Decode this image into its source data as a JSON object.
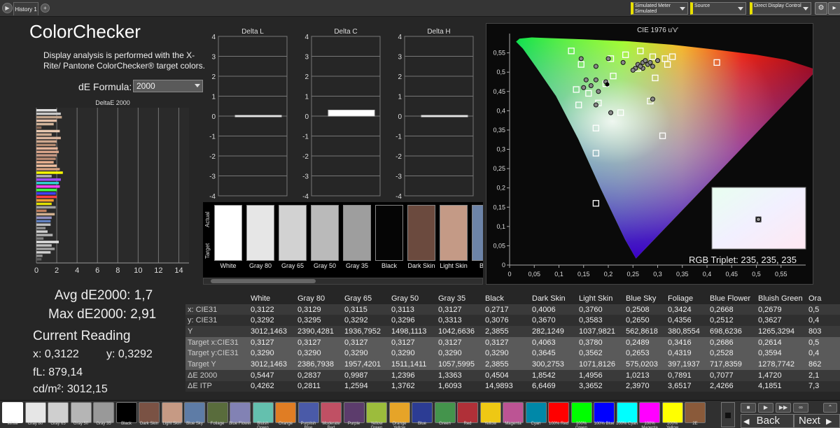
{
  "tabs": {
    "history": "History 1",
    "add": "+"
  },
  "toolbar": {
    "meter_line1": "Simulated Meter",
    "meter_line2": "Simulated",
    "source": "Source",
    "display_control": "Direct Display Control"
  },
  "title": "ColorChecker",
  "description": "Display analysis is performed with the X-Rite/ Pantone ColorChecker® target colors.",
  "de_formula": {
    "label": "dE Formula:",
    "value": "2000"
  },
  "stats": {
    "avg": "Avg dE2000: 1,7",
    "max": "Max dE2000: 2,91",
    "current_label": "Current Reading",
    "x": "x: 0,3122",
    "y": "y: 0,3292",
    "fl": "fL: 879,14",
    "cdm": "cd/m²: 3012,15"
  },
  "rgb_triplet": "RGB Triplet: 235, 235, 235",
  "chart_data": [
    {
      "type": "bar",
      "title": "DeltaE 2000",
      "orientation": "horizontal",
      "xlim": [
        0,
        15
      ],
      "xticks": [
        "0",
        "2",
        "4",
        "6",
        "8",
        "10",
        "12",
        "14"
      ],
      "values": [
        2.0,
        2.4,
        2.5,
        2.0,
        1.7,
        0.5,
        2.3,
        1.5,
        2.4,
        2.0,
        1.9,
        2.1,
        2.2,
        2.0,
        1.9,
        1.7,
        2.0,
        2.3,
        2.6,
        1.5,
        2.4,
        2.2,
        2.3,
        2.0,
        1.9,
        2.0,
        1.7,
        1.5,
        1.9,
        1.0,
        1.8,
        1.5,
        1.4,
        1.4,
        0.9,
        1.1,
        1.6,
        0.7,
        2.2,
        1.5,
        1.8,
        1.4,
        0.6,
        0.5
      ],
      "colors": [
        "#e0e0e0",
        "#c8c8c8",
        "#c2a48c",
        "#e4c0a8",
        "#d2b49a",
        "#8c6c5a",
        "#e8c8b0",
        "#ccaa90",
        "#d9b39c",
        "#cfa88e",
        "#b38a70",
        "#e5b59a",
        "#d9a58a",
        "#c89a84",
        "#b88a72",
        "#e8b090",
        "#f0c0a0",
        "#d4a080",
        "#ffff00",
        "#b0b0b0",
        "#a050ff",
        "#30d0d0",
        "#ff40ff",
        "#40ff40",
        "#4040ff",
        "#ff4040",
        "#ffa030",
        "#e0e000",
        "#a0a0a0",
        "#c08060",
        "#d0b090",
        "#9090c0",
        "#6080c0",
        "#c0c0c0",
        "#909090",
        "#d0d0d0",
        "#b0b0b0",
        "#808080",
        "#e0e0e0",
        "#c0c0c0",
        "#a0a0a0",
        "#d0d0d0",
        "#909090",
        "#606060"
      ]
    },
    {
      "type": "bar",
      "title": "Delta L",
      "ylim": [
        -4,
        4
      ],
      "yticks": [
        "4",
        "3",
        "2",
        "1",
        "0",
        "-1",
        "-2",
        "-3",
        "-4"
      ],
      "values": [
        0.0
      ]
    },
    {
      "type": "bar",
      "title": "Delta C",
      "ylim": [
        -4,
        4
      ],
      "yticks": [
        "4",
        "3",
        "2",
        "1",
        "0",
        "-1",
        "-2",
        "-3",
        "-4"
      ],
      "values": [
        0.3
      ]
    },
    {
      "type": "bar",
      "title": "Delta H",
      "ylim": [
        -4,
        4
      ],
      "yticks": [
        "4",
        "3",
        "2",
        "1",
        "0",
        "-1",
        "-2",
        "-3",
        "-4"
      ],
      "values": [
        0.0
      ]
    },
    {
      "type": "scatter",
      "title": "CIE 1976 u'v'",
      "xlim": [
        0,
        0.6
      ],
      "ylim": [
        0,
        0.6
      ],
      "xticks": [
        "0",
        "0,05",
        "0,1",
        "0,15",
        "0,2",
        "0,25",
        "0,3",
        "0,35",
        "0,4",
        "0,45",
        "0,5",
        "0,55"
      ],
      "yticks": [
        "0,55",
        "0,5",
        "0,45",
        "0,4",
        "0,35",
        "0,3",
        "0,25",
        "0,2",
        "0,15",
        "0,1",
        "0,05",
        "0"
      ],
      "targets": [
        [
          0.125,
          0.555
        ],
        [
          0.145,
          0.52
        ],
        [
          0.265,
          0.555
        ],
        [
          0.29,
          0.54
        ],
        [
          0.315,
          0.535
        ],
        [
          0.33,
          0.54
        ],
        [
          0.42,
          0.525
        ],
        [
          0.32,
          0.52
        ],
        [
          0.26,
          0.51
        ],
        [
          0.21,
          0.49
        ],
        [
          0.295,
          0.485
        ],
        [
          0.195,
          0.47
        ],
        [
          0.135,
          0.455
        ],
        [
          0.16,
          0.445
        ],
        [
          0.285,
          0.425
        ],
        [
          0.14,
          0.415
        ],
        [
          0.18,
          0.42
        ],
        [
          0.225,
          0.395
        ],
        [
          0.31,
          0.335
        ],
        [
          0.175,
          0.355
        ],
        [
          0.175,
          0.29
        ],
        [
          0.175,
          0.16
        ],
        [
          0.205,
          0.535
        ],
        [
          0.235,
          0.545
        ]
      ],
      "measured": [
        [
          0.145,
          0.535
        ],
        [
          0.175,
          0.515
        ],
        [
          0.2,
          0.535
        ],
        [
          0.23,
          0.525
        ],
        [
          0.26,
          0.52
        ],
        [
          0.27,
          0.525
        ],
        [
          0.275,
          0.53
        ],
        [
          0.28,
          0.52
        ],
        [
          0.29,
          0.515
        ],
        [
          0.3,
          0.53
        ],
        [
          0.285,
          0.525
        ],
        [
          0.27,
          0.51
        ],
        [
          0.265,
          0.515
        ],
        [
          0.255,
          0.51
        ],
        [
          0.25,
          0.505
        ],
        [
          0.195,
          0.475
        ],
        [
          0.175,
          0.48
        ],
        [
          0.155,
          0.48
        ],
        [
          0.165,
          0.465
        ],
        [
          0.175,
          0.415
        ],
        [
          0.205,
          0.395
        ],
        [
          0.29,
          0.43
        ],
        [
          0.18,
          0.45
        ],
        [
          0.15,
          0.46
        ]
      ],
      "white_point": [
        0.1978,
        0.4683
      ]
    }
  ],
  "table": {
    "columns": [
      "",
      "White",
      "Gray 80",
      "Gray 65",
      "Gray 50",
      "Gray 35",
      "Black",
      "Dark Skin",
      "Light Skin",
      "Blue Sky",
      "Foliage",
      "Blue Flower",
      "Bluish Green",
      "Ora"
    ],
    "rows": [
      {
        "label": "x: CIE31",
        "cells": [
          "0,3122",
          "0,3129",
          "0,3115",
          "0,3113",
          "0,3127",
          "0,2717",
          "0,4006",
          "0,3760",
          "0,2508",
          "0,3424",
          "0,2668",
          "0,2679",
          "0,5"
        ]
      },
      {
        "label": "y: CIE31",
        "cells": [
          "0,3292",
          "0,3295",
          "0,3292",
          "0,3296",
          "0,3313",
          "0,3076",
          "0,3670",
          "0,3583",
          "0,2650",
          "0,4356",
          "0,2512",
          "0,3627",
          "0,4"
        ]
      },
      {
        "label": "Y",
        "cells": [
          "3012,1463",
          "2390,4281",
          "1936,7952",
          "1498,1113",
          "1042,6636",
          "2,3855",
          "282,1249",
          "1037,9821",
          "562,8618",
          "380,8554",
          "698,6236",
          "1265,3294",
          "803"
        ]
      },
      {
        "label": "Target x:CIE31",
        "cells": [
          "0,3127",
          "0,3127",
          "0,3127",
          "0,3127",
          "0,3127",
          "0,3127",
          "0,4063",
          "0,3780",
          "0,2489",
          "0,3416",
          "0,2686",
          "0,2614",
          "0,5"
        ]
      },
      {
        "label": "Target y:CIE31",
        "cells": [
          "0,3290",
          "0,3290",
          "0,3290",
          "0,3290",
          "0,3290",
          "0,3290",
          "0,3645",
          "0,3562",
          "0,2653",
          "0,4319",
          "0,2528",
          "0,3594",
          "0,4"
        ]
      },
      {
        "label": "Target Y",
        "cells": [
          "3012,1463",
          "2386,7938",
          "1957,4201",
          "1511,1411",
          "1057,5995",
          "2,3855",
          "300,2753",
          "1071,8126",
          "575,0203",
          "397,1937",
          "717,8359",
          "1278,7742",
          "862"
        ]
      },
      {
        "label": "ΔE 2000",
        "cells": [
          "0,5447",
          "0,2837",
          "0,9987",
          "1,2396",
          "1,3363",
          "0,4504",
          "1,8542",
          "1,4956",
          "1,0213",
          "0,7891",
          "0,7077",
          "1,4720",
          "2,1"
        ]
      },
      {
        "label": "ΔE ITP",
        "cells": [
          "0,4262",
          "0,2811",
          "1,2594",
          "1,3762",
          "1,6093",
          "14,9893",
          "6,6469",
          "3,3652",
          "2,3970",
          "3,6517",
          "2,4266",
          "4,1851",
          "7,3"
        ]
      }
    ]
  },
  "preview": [
    {
      "label": "White",
      "color": "#ffffff"
    },
    {
      "label": "Gray 80",
      "color": "#e6e6e6"
    },
    {
      "label": "Gray 65",
      "color": "#d2d2d2"
    },
    {
      "label": "Gray 50",
      "color": "#bababa"
    },
    {
      "label": "Gray 35",
      "color": "#9e9e9e"
    },
    {
      "label": "Black",
      "color": "#050505"
    },
    {
      "label": "Dark Skin",
      "color": "#6b4a3e"
    },
    {
      "label": "Light Skin",
      "color": "#c49a86"
    },
    {
      "label": "Blue",
      "color": "#6d84a8"
    }
  ],
  "preview_axis": {
    "actual": "Actual",
    "target": "Target"
  },
  "swatches": [
    {
      "label": "White",
      "color": "#ffffff"
    },
    {
      "label": "Gray 80",
      "color": "#e6e6e6"
    },
    {
      "label": "Gray 65",
      "color": "#cfcfcf"
    },
    {
      "label": "Gray 50",
      "color": "#b5b5b5"
    },
    {
      "label": "Gray 35",
      "color": "#999999"
    },
    {
      "label": "Black",
      "color": "#000000"
    },
    {
      "label": "Dark Skin",
      "color": "#7a5244"
    },
    {
      "label": "Light Skin",
      "color": "#c69a84"
    },
    {
      "label": "Blue Sky",
      "color": "#5e7ca6"
    },
    {
      "label": "Foliage",
      "color": "#596c3c"
    },
    {
      "label": "Blue Flower",
      "color": "#8282b4"
    },
    {
      "label": "Bluish Green",
      "color": "#64c0ae"
    },
    {
      "label": "Orange",
      "color": "#e07d24"
    },
    {
      "label": "Purplish Blue",
      "color": "#4a5aa8"
    },
    {
      "label": "Moderate Red",
      "color": "#c05064"
    },
    {
      "label": "Purple",
      "color": "#5c3c6c"
    },
    {
      "label": "Yellow Green",
      "color": "#9cbc3c"
    },
    {
      "label": "Orange Yellow",
      "color": "#e6a428"
    },
    {
      "label": "Blue",
      "color": "#2c3c94"
    },
    {
      "label": "Green",
      "color": "#44944c"
    },
    {
      "label": "Red",
      "color": "#b03038"
    },
    {
      "label": "Yellow",
      "color": "#eec814"
    },
    {
      "label": "Magenta",
      "color": "#bc5494"
    },
    {
      "label": "Cyan",
      "color": "#0088a8"
    },
    {
      "label": "100% Red",
      "color": "#ff0000"
    },
    {
      "label": "100% Green",
      "color": "#00ff00"
    },
    {
      "label": "100% Blue",
      "color": "#0000ff"
    },
    {
      "label": "100% Cyan",
      "color": "#00ffff"
    },
    {
      "label": "100% Magenta",
      "color": "#ff00ff"
    },
    {
      "label": "100% Yellow",
      "color": "#ffff00"
    },
    {
      "label": "2E",
      "color": "#8a5a3a"
    }
  ],
  "controls": {
    "back": "Back",
    "next": "Next"
  }
}
